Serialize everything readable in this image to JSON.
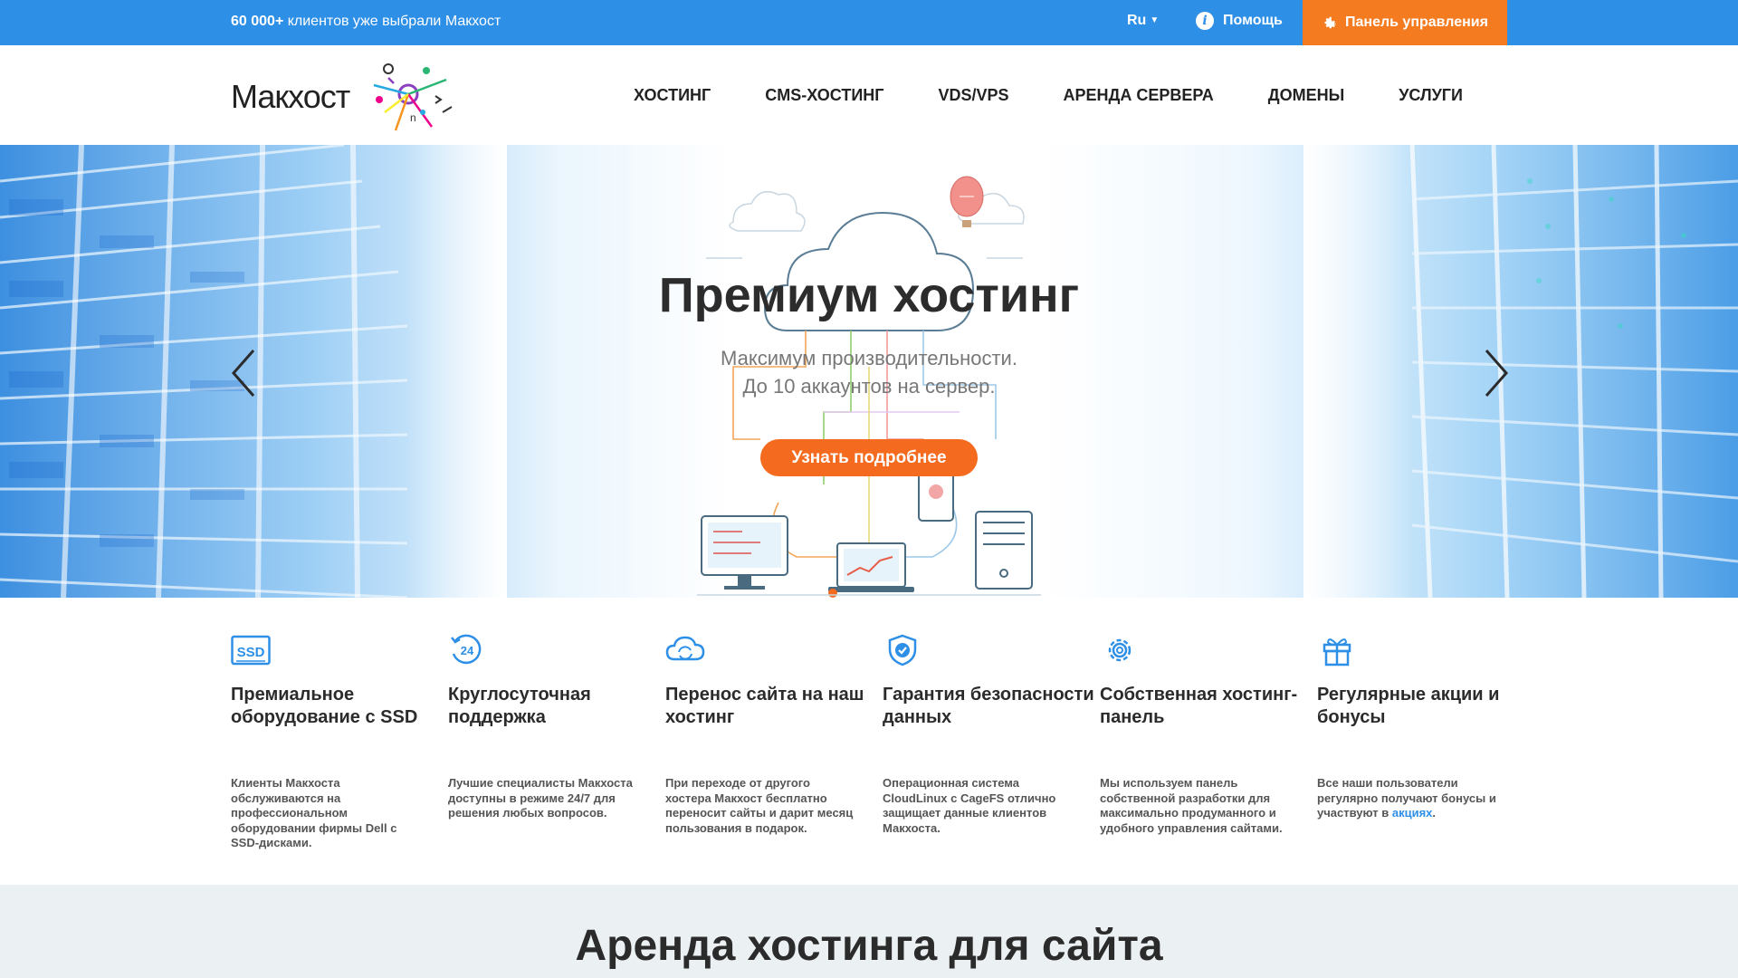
{
  "topbar": {
    "clients_count": "60 000+",
    "clients_text": " клиентов уже выбрали Макхост",
    "lang": "Ru",
    "help": "Помощь",
    "panel": "Панель управления"
  },
  "header": {
    "logo_text": "Макхост",
    "nav": [
      "ХОСТИНГ",
      "CMS-ХОСТИНГ",
      "VDS/VPS",
      "АРЕНДА СЕРВЕРА",
      "ДОМЕНЫ",
      "УСЛУГИ"
    ]
  },
  "hero": {
    "title": "Премиум хостинг",
    "subtitle_line1": "Максимум производительности.",
    "subtitle_line2": "До 10 аккаунтов на сервер.",
    "button": "Узнать подробнее"
  },
  "features": [
    {
      "icon": "ssd-icon",
      "title": "Премиальное оборудование с SSD",
      "text": "Клиенты Макхоста обслуживаются на профессиональном оборудовании фирмы Dell с SSD-дисками."
    },
    {
      "icon": "support-24-icon",
      "title": "Круглосуточная поддержка",
      "text": "Лучшие специалисты Макхоста доступны в режиме 24/7 для решения любых вопросов."
    },
    {
      "icon": "cloud-transfer-icon",
      "title": "Перенос сайта на наш хостинг",
      "text": "При переходе от другого хостера Макхост бесплатно переносит сайты и дарит месяц пользования в подарок."
    },
    {
      "icon": "shield-check-icon",
      "title": "Гарантия безопасности данных",
      "text": "Операционная система CloudLinux с CageFS отлично защищает данные клиентов Макхоста."
    },
    {
      "icon": "gear-icon",
      "title": "Собственная хостинг-панель",
      "text": "Мы используем панель собственной разработки для максимально продуманного и удобного управления сайтами."
    },
    {
      "icon": "gift-icon",
      "title": "Регулярные акции и бонусы",
      "text": "Все наши пользователи регулярно получают бонусы и участвуют в ",
      "link": "акциях",
      "text_after": "."
    }
  ],
  "section": {
    "title": "Аренда хостинга для сайта"
  },
  "colors": {
    "topbar": "#2e8fe6",
    "panel_button": "#f47b20",
    "cta": "#f46a1f",
    "icons": "#2e8fe6"
  }
}
